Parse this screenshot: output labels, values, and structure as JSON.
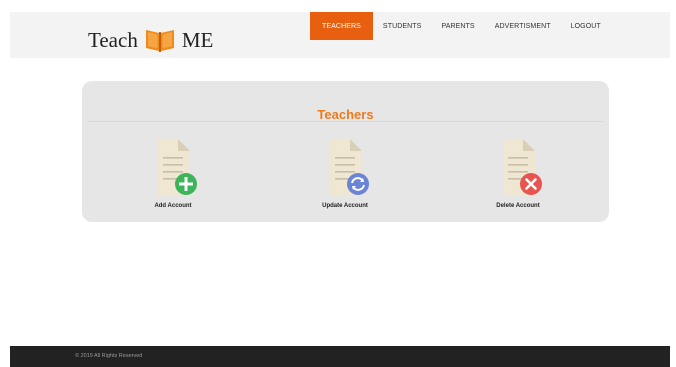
{
  "header": {
    "logo_left": "Teach",
    "logo_right": "ME",
    "logo_icon": "open-book-icon",
    "nav": [
      {
        "label": "TEACHERS",
        "active": true
      },
      {
        "label": "STUDENTS",
        "active": false
      },
      {
        "label": "PARENTS",
        "active": false
      },
      {
        "label": "ADVERTISMENT",
        "active": false
      },
      {
        "label": "LOGOUT",
        "active": false
      }
    ]
  },
  "main": {
    "title": "Teachers",
    "actions": [
      {
        "label": "Add Account",
        "icon": "document-add-icon",
        "badge_color": "#3db35a"
      },
      {
        "label": "Update Account",
        "icon": "document-update-icon",
        "badge_color": "#6a84d6"
      },
      {
        "label": "Delete Account",
        "icon": "document-delete-icon",
        "badge_color": "#e8544f"
      }
    ]
  },
  "footer": {
    "text": "© 2019 All Rights Reserved"
  },
  "colors": {
    "accent": "#e8600f",
    "title": "#ef7a1a",
    "card_bg": "#e6e6e6",
    "footer_bg": "#222222"
  }
}
